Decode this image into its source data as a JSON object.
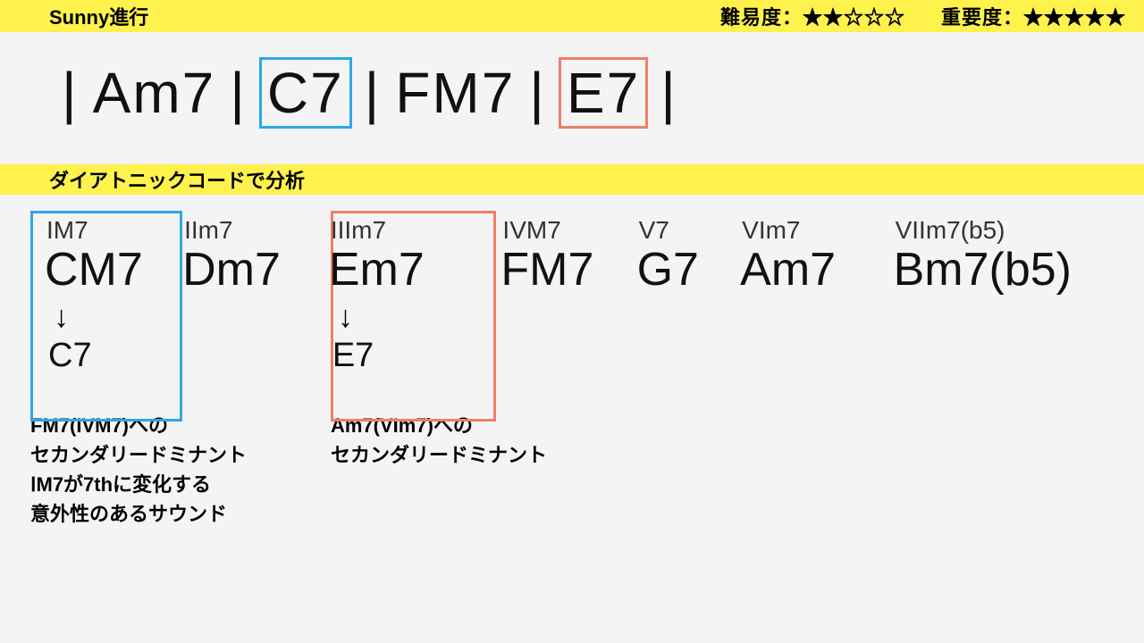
{
  "header": {
    "title": "Sunny進行",
    "difficulty_label": "難易度：★★☆☆☆",
    "importance_label": "重要度：★★★★★"
  },
  "progression": {
    "sep": "|",
    "chords": [
      {
        "name": "Am7",
        "box": null
      },
      {
        "name": "C7",
        "box": "blue"
      },
      {
        "name": "FM7",
        "box": null
      },
      {
        "name": "E7",
        "box": "red"
      }
    ]
  },
  "section": {
    "title": "ダイアトニックコードで分析"
  },
  "diatonic": [
    {
      "roman": "IM7",
      "chord": "CM7",
      "arrow": "↓",
      "sub": "C7"
    },
    {
      "roman": "IIm7",
      "chord": "Dm7",
      "arrow": "",
      "sub": ""
    },
    {
      "roman": "IIIm7",
      "chord": "Em7",
      "arrow": "↓",
      "sub": "E7"
    },
    {
      "roman": "IVM7",
      "chord": "FM7",
      "arrow": "",
      "sub": ""
    },
    {
      "roman": "V7",
      "chord": "G7",
      "arrow": "",
      "sub": ""
    },
    {
      "roman": "VIm7",
      "chord": "Am7",
      "arrow": "",
      "sub": ""
    },
    {
      "roman": "VIIm7(b5)",
      "chord": "Bm7(b5)",
      "arrow": "",
      "sub": ""
    }
  ],
  "notes": {
    "n1": "FM7(IVM7)への\nセカンダリードミナント\nⅠM7が7thに変化する\n意外性のあるサウンド",
    "n2": "Am7(VIm7)への\nセカンダリードミナント"
  }
}
